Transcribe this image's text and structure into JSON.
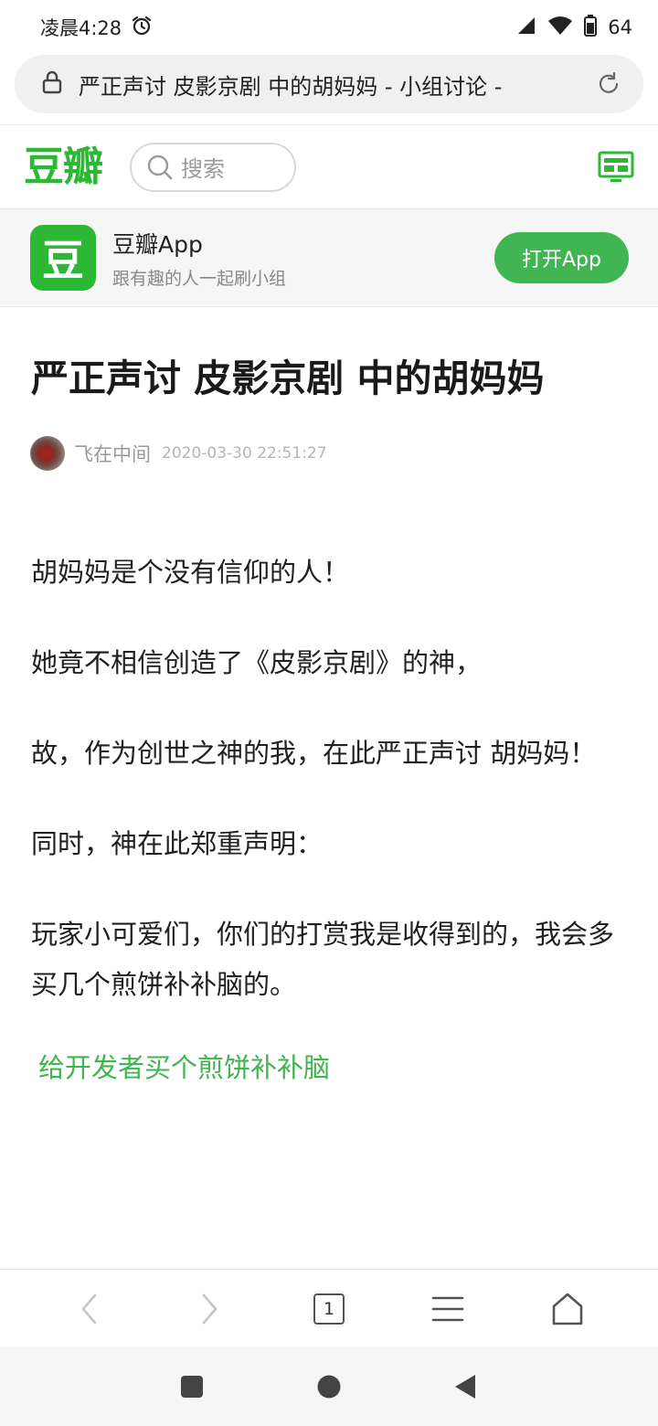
{
  "status_bar": {
    "time": "凌晨4:28",
    "battery": "64",
    "icons": [
      "alarm-icon",
      "signal-icon",
      "wifi-icon",
      "battery-icon"
    ]
  },
  "url_bar": {
    "text": "严正声讨 皮影京剧 中的胡妈妈 - 小组讨论 -"
  },
  "site": {
    "logo": "豆瓣",
    "search_placeholder": "搜索",
    "brand_color": "#2cb734"
  },
  "app_banner": {
    "icon_char": "豆",
    "name": "豆瓣App",
    "slogan": "跟有趣的人一起刷小组",
    "open_label": "打开App"
  },
  "post": {
    "title": "严正声讨 皮影京剧 中的胡妈妈",
    "author": "飞在中间",
    "time": "2020-03-30 22:51:27",
    "paragraphs": [
      "胡妈妈是个没有信仰的人！",
      "她竟不相信创造了《皮影京剧》的神，",
      "故，作为创世之神的我，在此严正声讨 胡妈妈！",
      "同时，神在此郑重声明：",
      "玩家小可爱们，你们的打赏我是收得到的，我会多买几个煎饼补补脑的。"
    ],
    "donate_link": "给开发者买个煎饼补补脑",
    "link_color": "#3fb44f"
  },
  "browser_toolbar": {
    "tab_count": "1",
    "icons": [
      "back-icon",
      "forward-icon",
      "tabs-icon",
      "menu-icon",
      "home-icon"
    ]
  },
  "system_nav": {
    "icons": [
      "recents-icon",
      "home-circle-icon",
      "back-triangle-icon"
    ]
  }
}
